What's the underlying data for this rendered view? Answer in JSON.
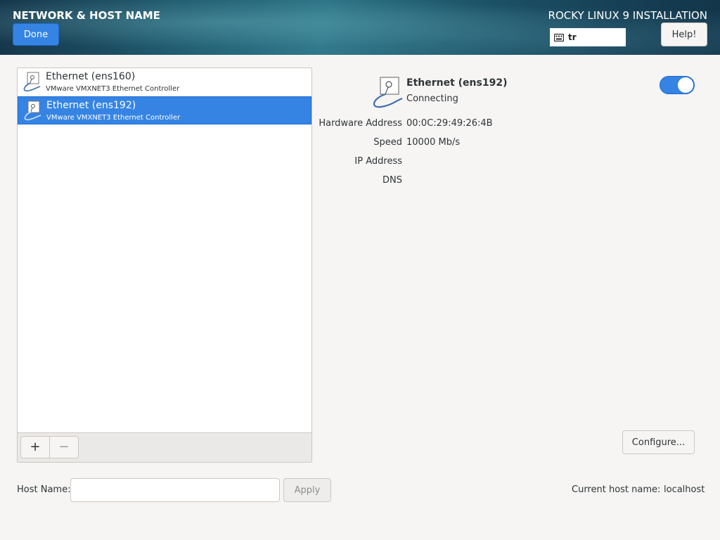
{
  "header": {
    "spoke_title": "NETWORK & HOST NAME",
    "done_label": "Done",
    "product_title": "ROCKY LINUX 9 INSTALLATION",
    "keyboard_layout": "tr",
    "help_label": "Help!"
  },
  "devices": [
    {
      "name": "Ethernet (ens160)",
      "description": "VMware VMXNET3 Ethernet Controller",
      "selected": false
    },
    {
      "name": "Ethernet (ens192)",
      "description": "VMware VMXNET3 Ethernet Controller",
      "selected": true
    }
  ],
  "toolbar": {
    "add_label": "+",
    "remove_label": "−"
  },
  "detail": {
    "name": "Ethernet (ens192)",
    "status": "Connecting",
    "toggle_on": true,
    "properties": [
      {
        "label": "Hardware Address",
        "value": "00:0C:29:49:26:4B"
      },
      {
        "label": "Speed",
        "value": "10000 Mb/s"
      },
      {
        "label": "IP Address",
        "value": ""
      },
      {
        "label": "DNS",
        "value": ""
      }
    ],
    "configure_label": "Configure..."
  },
  "hostname": {
    "label": "Host Name:",
    "value": "",
    "placeholder": "",
    "apply_label": "Apply",
    "current_label": "Current host name:",
    "current_value": "localhost"
  },
  "colors": {
    "accent": "#3584e4",
    "header_dark": "#16354a"
  },
  "icons": [
    "keyboard-icon",
    "ethernet-icon",
    "toggle-switch"
  ]
}
